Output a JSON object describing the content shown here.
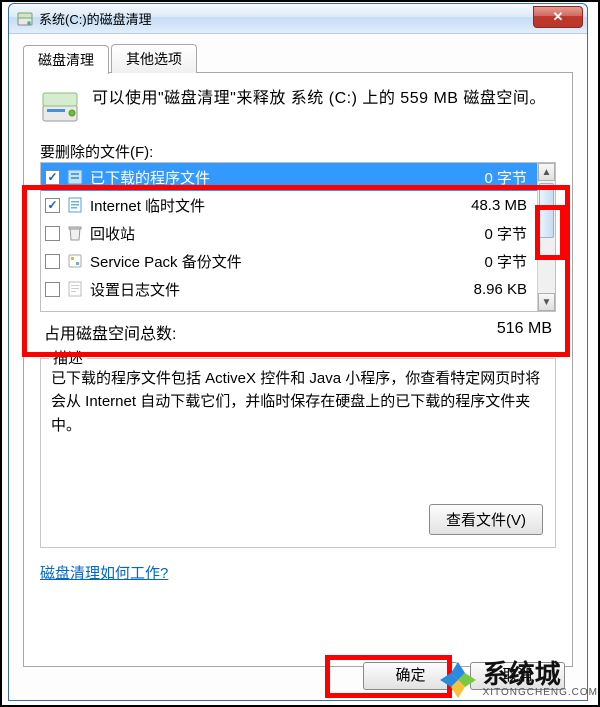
{
  "title": "系统(C:)的磁盘清理",
  "tabs": {
    "cleanup": "磁盘清理",
    "other": "其他选项"
  },
  "intro": "可以使用\"磁盘清理\"来释放 系统 (C:) 上的 559 MB 磁盘空间。",
  "section_label": "要删除的文件(F):",
  "files": [
    {
      "checked": true,
      "name": "已下载的程序文件",
      "size": "0 字节",
      "selected": true
    },
    {
      "checked": true,
      "name": "Internet 临时文件",
      "size": "48.3 MB",
      "selected": false
    },
    {
      "checked": false,
      "name": "回收站",
      "size": "0 字节",
      "selected": false
    },
    {
      "checked": false,
      "name": "Service Pack 备份文件",
      "size": "0 字节",
      "selected": false
    },
    {
      "checked": false,
      "name": "设置日志文件",
      "size": "8.96 KB",
      "selected": false
    }
  ],
  "total_label": "占用磁盘空间总数:",
  "total_value": "516 MB",
  "desc_legend": "描述",
  "desc_text": "已下载的程序文件包括 ActiveX 控件和 Java 小程序，你查看特定网页时将会从 Internet 自动下载它们，并临时保存在硬盘上的已下载的程序文件夹中。",
  "view_files_btn": "查看文件(V)",
  "help_link": "磁盘清理如何工作?",
  "ok_btn": "确定",
  "cancel_btn": "取消",
  "watermark": {
    "main": "系统城",
    "sub": "XITONGCHENG.COM"
  }
}
